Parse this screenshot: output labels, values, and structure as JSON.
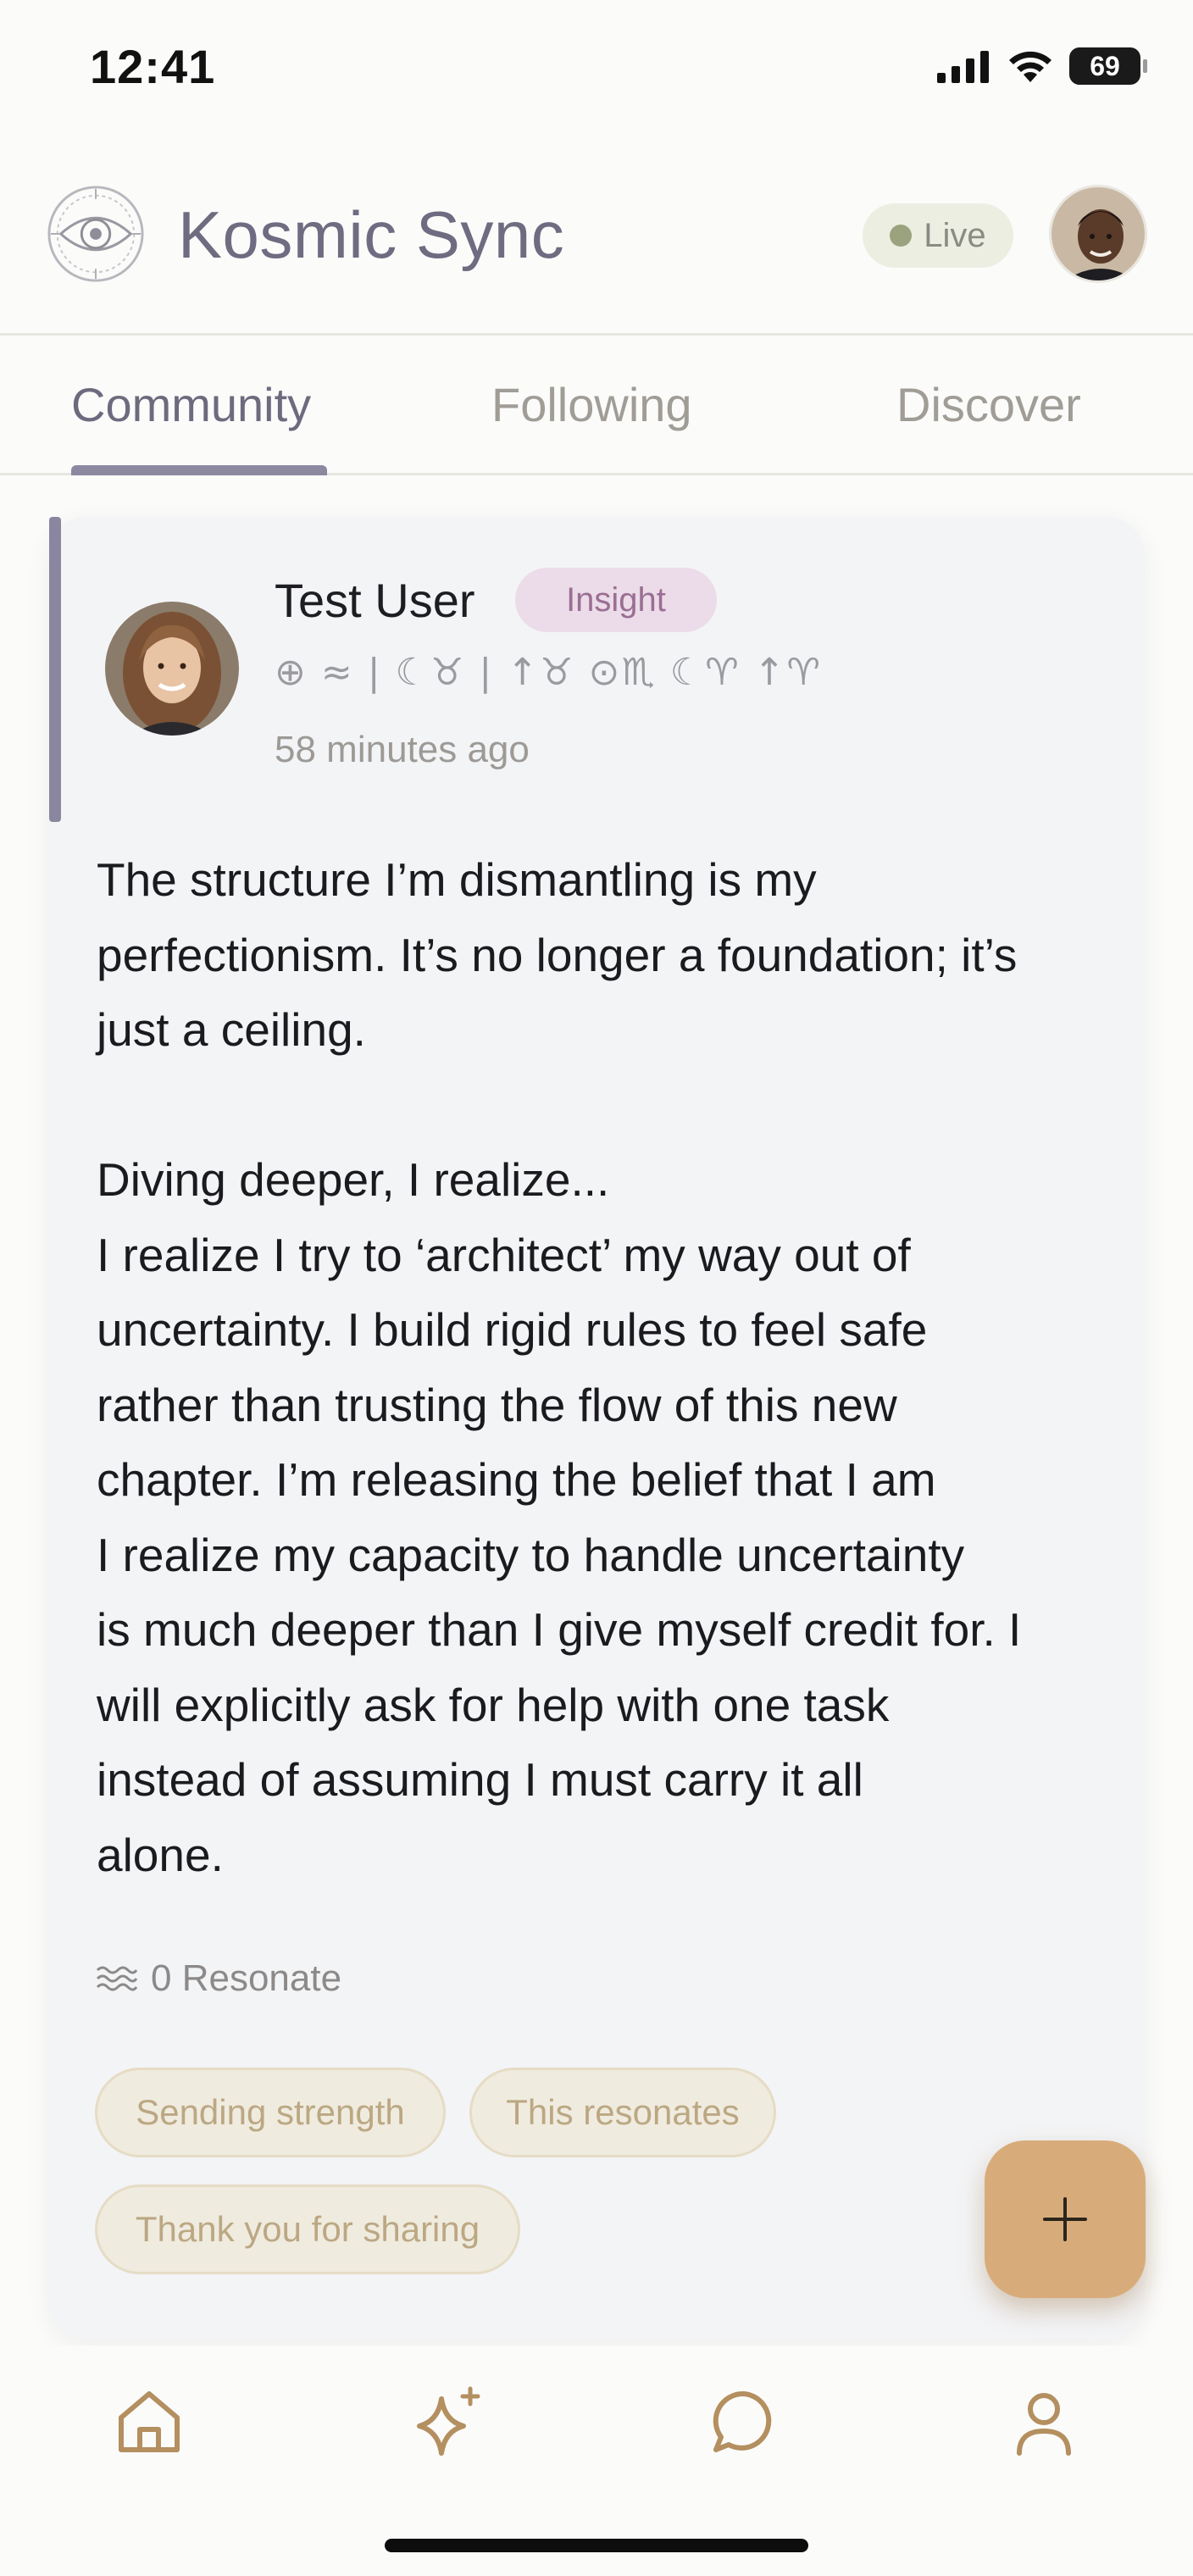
{
  "status_bar": {
    "time": "12:41",
    "battery": "69"
  },
  "header": {
    "app_title": "Kosmic Sync",
    "live_label": "Live"
  },
  "tabs": [
    {
      "label": "Community",
      "active": true
    },
    {
      "label": "Following",
      "active": false
    },
    {
      "label": "Discover",
      "active": false
    }
  ],
  "post": {
    "author": "Test User",
    "type_badge": "Insight",
    "astro_line": "⊕ ≈ | ☾♉ | ↑♉   ⊙♏ ☾♈ ↑♈",
    "time_ago": "58 minutes ago",
    "paragraph_1": [
      "The structure I’m dismantling is my",
      "perfectionism. It’s no longer a foundation; it’s",
      "just a ceiling."
    ],
    "paragraph_2": [
      "Diving deeper, I realize...",
      "I realize I try to ‘architect’ my way out of",
      "uncertainty. I build rigid rules to feel safe",
      "rather than trusting the flow of this new",
      "chapter. I’m releasing the belief that I am",
      "I realize my capacity to handle uncertainty",
      "is much deeper than I give myself credit for. I",
      "will explicitly ask for help with one task",
      "instead of assuming I must carry it all",
      "alone."
    ],
    "resonate_label": "0 Resonate",
    "reactions": [
      "Sending strength",
      "This resonates",
      "Thank you for sharing"
    ]
  },
  "fab": {
    "icon": "plus-icon"
  },
  "bottom_nav": [
    {
      "icon": "home-icon"
    },
    {
      "icon": "sparkle-icon"
    },
    {
      "icon": "chat-icon"
    },
    {
      "icon": "profile-icon"
    }
  ],
  "colors": {
    "accent": "#8a86a0",
    "fab": "#d8ac7a",
    "nav_icons": "#b48f5f",
    "chip_bg": "#f0ebdf",
    "badge_bg": "#ecdbe9"
  }
}
